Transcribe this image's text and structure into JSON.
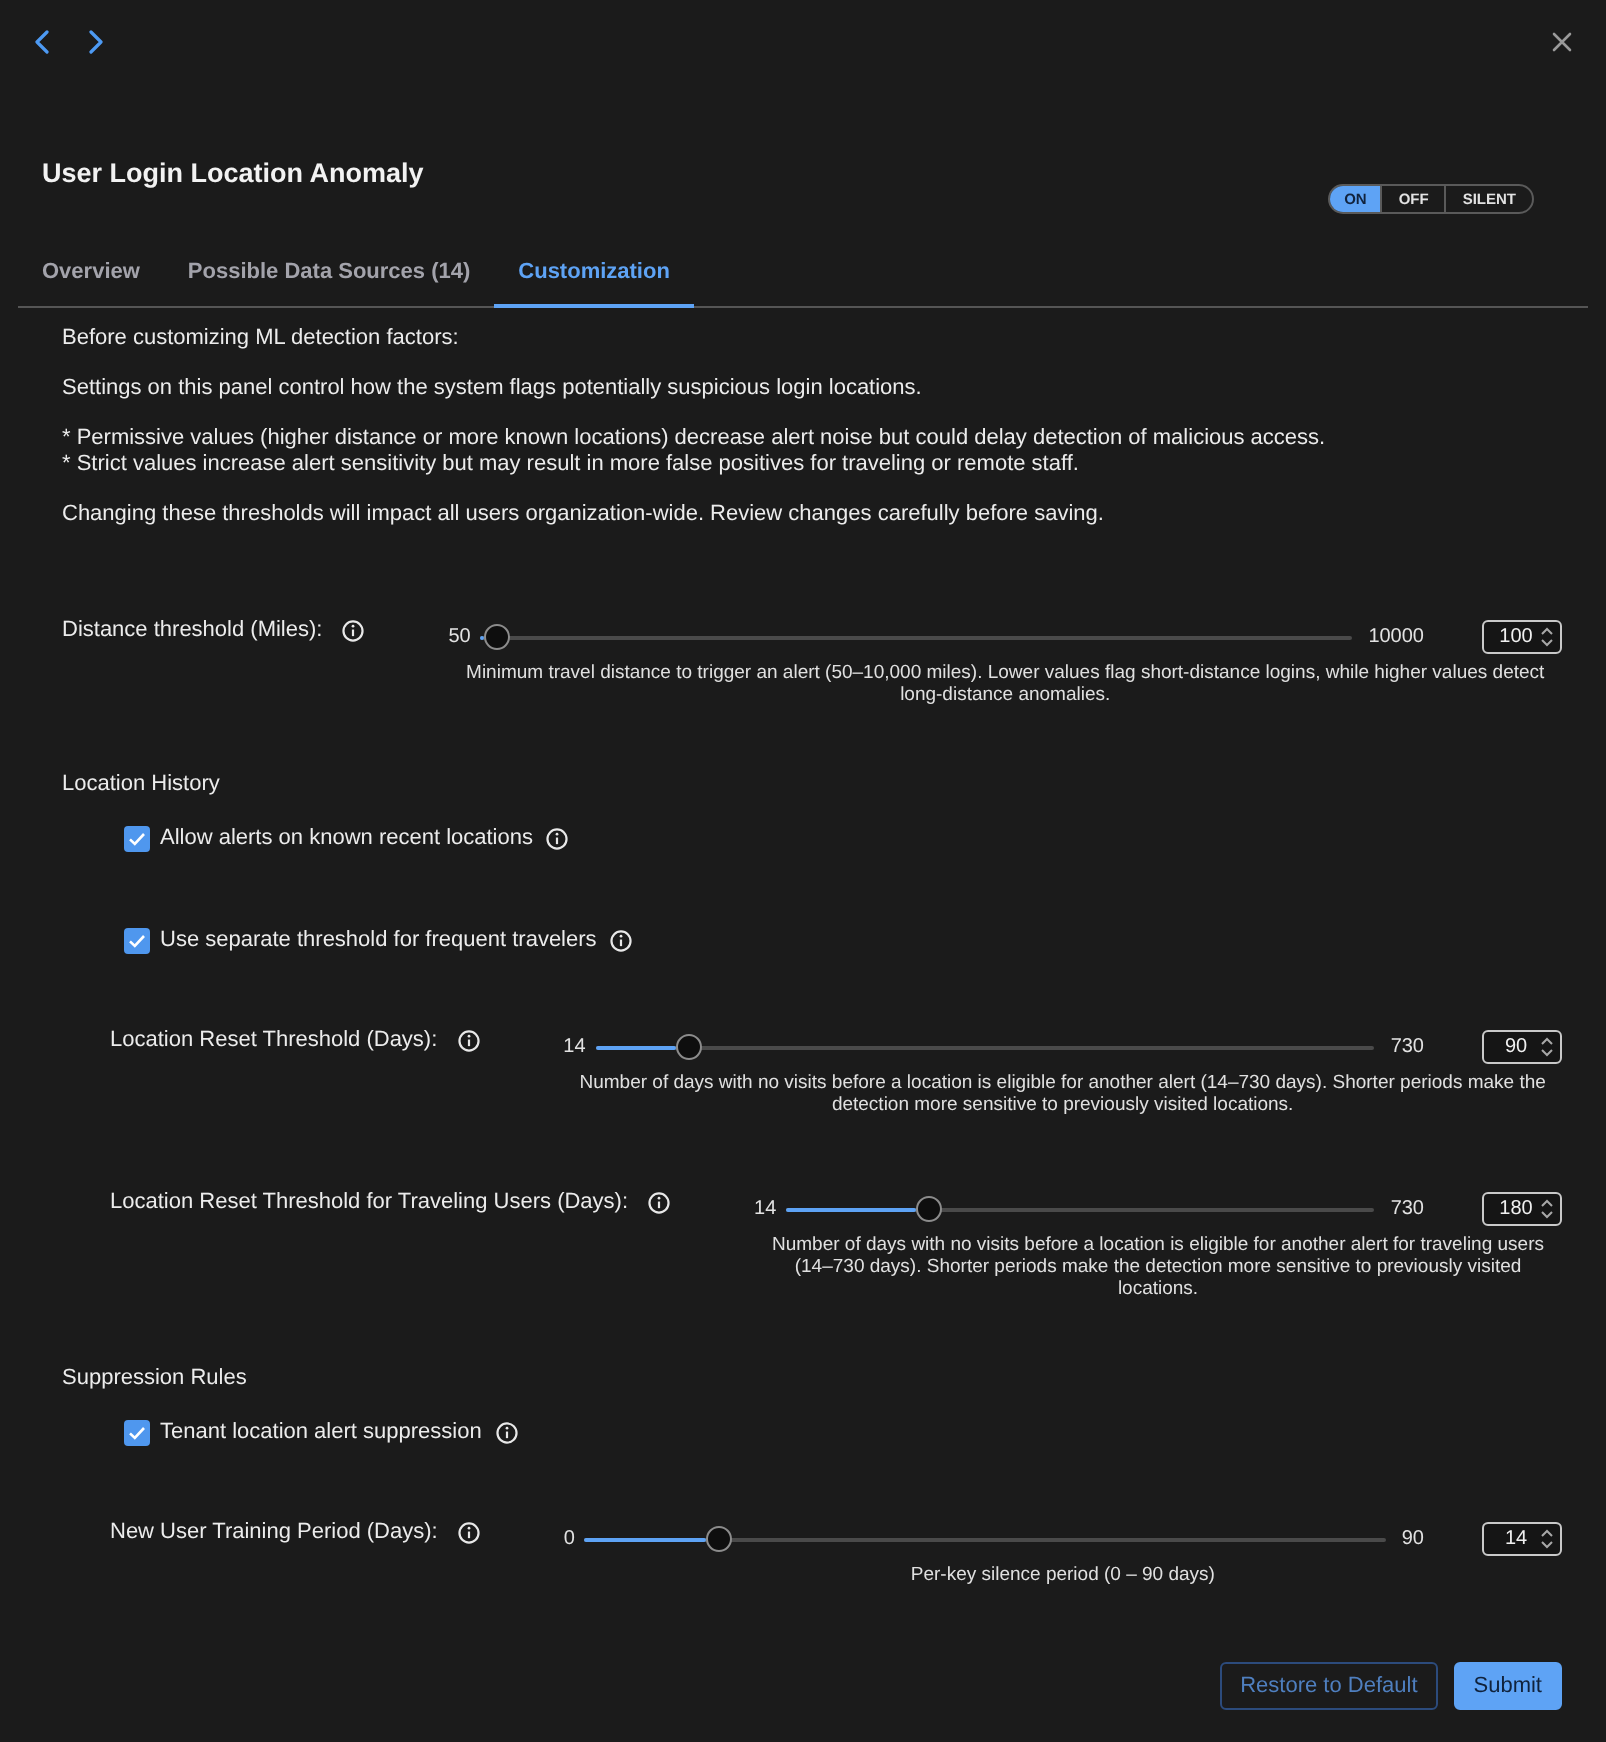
{
  "title": "User Login Location Anomaly",
  "mode_switch": [
    {
      "label": "ON",
      "selected": true
    },
    {
      "label": "OFF",
      "selected": false
    },
    {
      "label": "SILENT",
      "selected": false
    }
  ],
  "tabs": [
    {
      "label": "Overview",
      "selected": false
    },
    {
      "label": "Possible Data Sources (14)",
      "selected": false
    },
    {
      "label": "Customization",
      "selected": true
    }
  ],
  "intro": [
    {
      "lines": [
        "Before customizing ML detection factors:"
      ]
    },
    {
      "lines": [
        "Settings on this panel control how the system flags potentially suspicious login locations."
      ]
    },
    {
      "lines": [
        "* Permissive values (higher distance or more known locations) decrease alert noise but could delay detection of malicious access.",
        "* Strict values increase alert sensitivity but may result in more false positives for traveling or remote staff."
      ]
    },
    {
      "lines": [
        "Changing these thresholds will impact all users organization-wide. Review changes carefully before saving."
      ]
    }
  ],
  "distance": {
    "label": "Distance threshold (Miles):",
    "min_label": "50",
    "max_label": "10000",
    "level": 0.005,
    "value": "100",
    "description": "Minimum travel distance to trigger an alert (50–10,000 miles). Lower values flag short-distance logins, while higher values detect long-distance anomalies."
  },
  "sections": [
    {
      "heading": "Location History",
      "items": [
        {
          "kind": "checkbox",
          "label": "Allow alerts on known recent locations",
          "checked": true
        },
        {
          "kind": "checkbox",
          "label": "Use separate threshold for frequent travelers",
          "checked": true
        },
        {
          "kind": "slider",
          "label": "Location Reset Threshold (Days):",
          "min_label": "14",
          "max_label": "730",
          "level": 0.106,
          "value": "90",
          "description": "Number of days with no visits before a location is eligible for another alert (14–730 days). Shorter periods make the detection more sensitive to previously visited locations."
        },
        {
          "kind": "slider",
          "label": "Location Reset Threshold for Traveling Users (Days):",
          "min_label": "14",
          "max_label": "730",
          "level": 0.232,
          "value": "180",
          "description": "Number of days with no visits before a location is eligible for another alert for traveling users (14–730 days). Shorter periods make the detection more sensitive to previously visited locations."
        }
      ]
    },
    {
      "heading": "Suppression Rules",
      "items": [
        {
          "kind": "checkbox",
          "label": "Tenant location alert suppression",
          "checked": true
        },
        {
          "kind": "slider",
          "label": "New User Training Period (Days):",
          "min_label": "0",
          "max_label": "90",
          "level": 0.156,
          "value": "14",
          "description": "Per-key silence period (0 – 90 days)"
        }
      ]
    }
  ],
  "buttons": [
    {
      "label": "Restore to Default",
      "kind": "outline"
    },
    {
      "label": "Submit",
      "kind": "primary"
    }
  ]
}
